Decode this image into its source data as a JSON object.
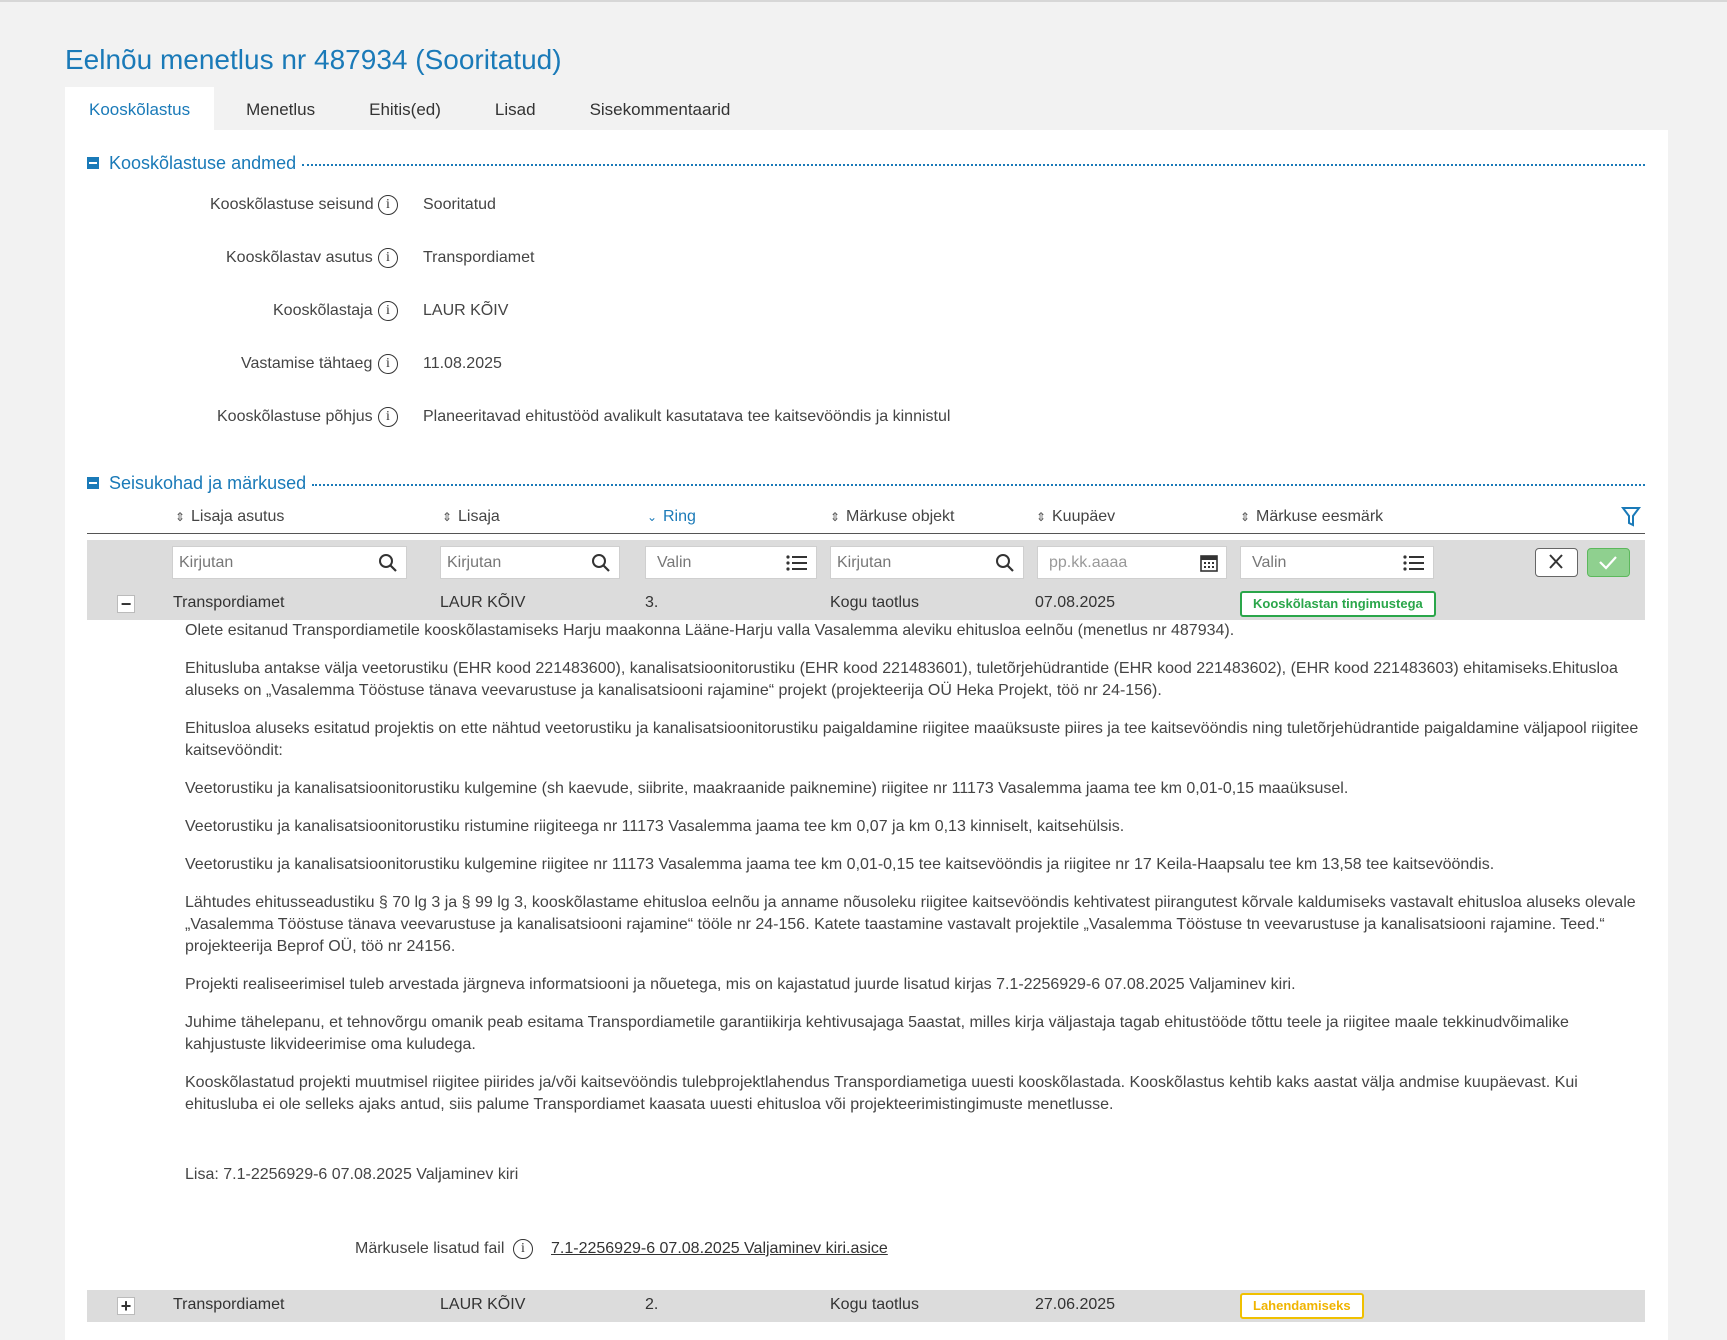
{
  "page": {
    "title": "Eelnõu menetlus nr 487934 (Sooritatud)"
  },
  "tabs": [
    {
      "label": "Kooskõlastus",
      "active": true
    },
    {
      "label": "Menetlus",
      "active": false
    },
    {
      "label": "Ehitis(ed)",
      "active": false
    },
    {
      "label": "Lisad",
      "active": false
    },
    {
      "label": "Sisekommentaarid",
      "active": false
    }
  ],
  "approval_section": {
    "title": "Kooskõlastuse andmed",
    "fields": [
      {
        "label": "Kooskõlastuse seisund",
        "value": "Sooritatud"
      },
      {
        "label": "Kooskõlastav asutus",
        "value": "Transpordiamet"
      },
      {
        "label": "Kooskõlastaja",
        "value": "LAUR KÕIV"
      },
      {
        "label": "Vastamise tähtaeg",
        "value": "11.08.2025"
      },
      {
        "label": "Kooskõlastuse põhjus",
        "value": "Planeeritavad ehitustööd avalikult kasutatava tee kaitsevööndis ja kinnistul"
      }
    ]
  },
  "remarks_section": {
    "title": "Seisukohad ja märkused",
    "columns": [
      "Lisaja asutus",
      "Lisaja",
      "Ring",
      "Märkuse objekt",
      "Kuupäev",
      "Märkuse eesmärk"
    ],
    "filters": {
      "asutus_placeholder": "Kirjutan",
      "lisaja_placeholder": "Kirjutan",
      "ring_placeholder": "Valin",
      "objekt_placeholder": "Kirjutan",
      "kuupaev_placeholder": "pp.kk.aaaa",
      "eesmark_placeholder": "Valin"
    },
    "rows": [
      {
        "toggle": "−",
        "asutus": "Transpordiamet",
        "lisaja": "LAUR KÕIV",
        "ring": "3.",
        "objekt": "Kogu taotlus",
        "kuupaev": "07.08.2025",
        "eesmark": "Kooskõlastan tingimustega"
      },
      {
        "toggle": "+",
        "asutus": "Transpordiamet",
        "lisaja": "LAUR KÕIV",
        "ring": "2.",
        "objekt": "Kogu taotlus",
        "kuupaev": "27.06.2025",
        "eesmark": "Lahendamiseks"
      }
    ],
    "detail": {
      "paragraphs": [
        "Olete esitanud Transpordiametile kooskõlastamiseks Harju maakonna Lääne-Harju valla Vasalemma aleviku ehitusloa eelnõu (menetlus nr 487934).",
        "Ehitusluba antakse välja veetorustiku (EHR kood 221483600), kanalisatsioonitorustiku (EHR kood 221483601), tuletõrjehüdrantide (EHR kood 221483602), (EHR kood 221483603) ehitamiseks.Ehitusloa aluseks on „Vasalemma Tööstuse tänava veevarustuse ja kanalisatsiooni rajamine“ projekt (projekteerija OÜ Heka Projekt, töö nr 24-156).",
        "Ehitusloa aluseks esitatud projektis on ette nähtud veetorustiku ja kanalisatsioonitorustiku paigaldamine riigitee maaüksuste piires ja tee kaitsevööndis ning tuletõrjehüdrantide paigaldamine väljapool riigitee kaitsevööndit:",
        "Veetorustiku ja kanalisatsioonitorustiku kulgemine (sh kaevude, siibrite, maakraanide paiknemine) riigitee nr 11173 Vasalemma jaama tee km 0,01-0,15 maaüksusel.",
        "Veetorustiku ja kanalisatsioonitorustiku ristumine riigiteega nr 11173 Vasalemma jaama tee km 0,07 ja km 0,13 kinniselt, kaitsehülsis.",
        "Veetorustiku ja kanalisatsioonitorustiku kulgemine riigitee nr 11173 Vasalemma jaama tee km 0,01-0,15 tee kaitsevööndis ja riigitee nr 17 Keila-Haapsalu tee km 13,58 tee kaitsevööndis.",
        "Lähtudes ehitusseadustiku § 70 lg 3 ja § 99 lg 3, kooskõlastame ehitusloa eelnõu ja anname nõusoleku riigitee kaitsevööndis kehtivatest piirangutest kõrvale kaldumiseks vastavalt ehitusloa aluseks olevale „Vasalemma Tööstuse tänava veevarustuse ja kanalisatsiooni rajamine“ tööle nr 24-156. Katete taastamine vastavalt projektile „Vasalemma Tööstuse tn veevarustuse ja kanalisatsiooni rajamine. Teed.“ projekteerija Beprof OÜ, töö nr 24156.",
        "Projekti realiseerimisel tuleb arvestada järgneva informatsiooni ja nõuetega, mis on kajastatud juurde lisatud kirjas 7.1-2256929-6 07.08.2025 Valjaminev kiri.",
        "Juhime tähelepanu, et tehnovõrgu omanik peab esitama Transpordiametile garantiikirja kehtivusajaga 5aastat, milles kirja väljastaja tagab ehitustööde tõttu teele ja riigitee maale tekkinudvõimalike kahjustuste likvideerimise oma kuludega.",
        "Kooskõlastatud projekti muutmisel riigitee piirides ja/või kaitsevööndis tulebprojektlahendus Transpordiametiga uuesti kooskõlastada. Kooskõlastus kehtib kaks aastat välja andmise kuupäevast. Kui ehitusluba ei ole selleks ajaks antud, siis palume Transpordiamet kaasata uuesti ehitusloa või projekteerimistingimuste menetlusse."
      ],
      "attachment_note": "Lisa: 7.1-2256929-6 07.08.2025 Valjaminev kiri",
      "file_label": "Märkusele lisatud fail",
      "file_name": "7.1-2256929-6 07.08.2025 Valjaminev kiri.asice"
    }
  },
  "colors": {
    "accent": "#1a7ab8",
    "badge_green": "#2aa64a",
    "badge_yellow": "#f0b400"
  }
}
